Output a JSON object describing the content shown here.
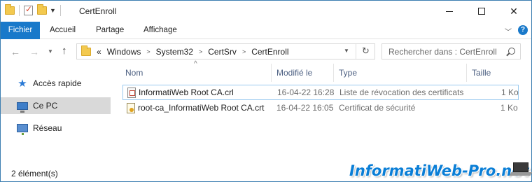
{
  "window": {
    "title": "CertEnroll"
  },
  "ribbon": {
    "tabs": [
      "Fichier",
      "Accueil",
      "Partage",
      "Affichage"
    ],
    "active_tab": "Fichier"
  },
  "address": {
    "prefix": "«",
    "crumbs": [
      "Windows",
      "System32",
      "CertSrv",
      "CertEnroll"
    ]
  },
  "search": {
    "placeholder": "Rechercher dans : CertEnroll"
  },
  "nav_pane": {
    "items": [
      {
        "label": "Accès rapide",
        "icon": "star-icon"
      },
      {
        "label": "Ce PC",
        "icon": "computer-icon",
        "selected": true
      },
      {
        "label": "Réseau",
        "icon": "network-icon"
      }
    ]
  },
  "columns": {
    "name": "Nom",
    "date": "Modifié le",
    "type": "Type",
    "size": "Taille"
  },
  "files": [
    {
      "name": "InformatiWeb Root CA.crl",
      "date": "16-04-22 16:28",
      "type": "Liste de révocation des certificats",
      "size": "1 Ko",
      "icon": "crl-file-icon",
      "selected": true
    },
    {
      "name": "root-ca_InformatiWeb Root CA.crt",
      "date": "16-04-22 16:05",
      "type": "Certificat de sécurité",
      "size": "1 Ko",
      "icon": "certificate-file-icon",
      "selected": false
    }
  ],
  "status": {
    "item_count": "2 élément(s)"
  },
  "watermark": {
    "text": "InformatiWeb-Pro.net"
  },
  "colors": {
    "accent": "#1979ca",
    "selection_border": "#99c9ef",
    "nav_selected": "#d9d9d9",
    "watermark": "#0a7ed6"
  }
}
